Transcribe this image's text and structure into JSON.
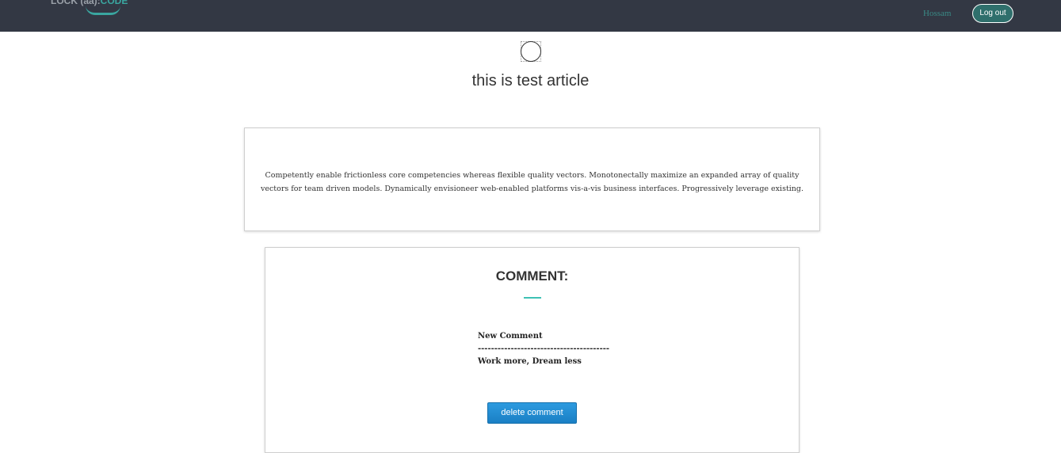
{
  "navbar": {
    "logo": {
      "text_main": "LOCK (aa):",
      "text_accent": "CODE"
    },
    "user_name": "Hossam",
    "logout_label": "Log out"
  },
  "article": {
    "title": "this is test article",
    "body": "Competently enable frictionless core competencies whereas flexible quality vectors. Monotonectally maximize an expanded array of quality vectors for team driven models. Dynamically envisioneer web-enabled platforms vis-a-vis business interfaces. Progressively leverage existing."
  },
  "comments": {
    "heading": "COMMENT:",
    "items": [
      {
        "title": "New Comment",
        "separator": "----------------------------------------",
        "text": "Work more, Dream less"
      }
    ],
    "delete_label": "delete comment"
  },
  "colors": {
    "navbar_bg": "#333844",
    "accent": "#3ec1b4",
    "button_blue": "#1a7fc4"
  }
}
